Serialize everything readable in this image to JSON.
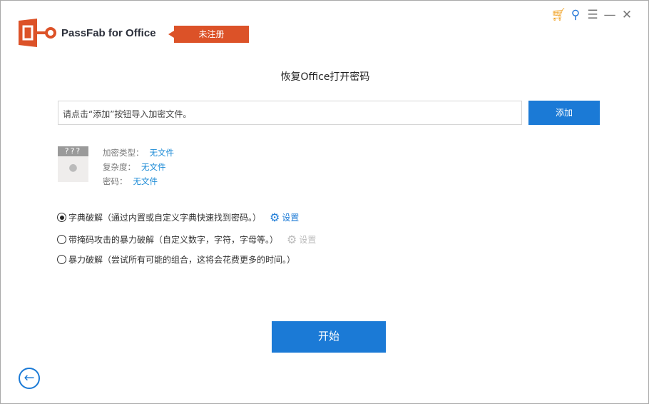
{
  "app": {
    "name": "PassFab for Office",
    "badge": "未注册"
  },
  "titlebar": {
    "icons": [
      "cart-icon",
      "key-icon",
      "menu-icon",
      "minimize-icon",
      "close-icon"
    ]
  },
  "main": {
    "title": "恢复Office打开密码",
    "file_input_placeholder": "请点击“添加”按钮导入加密文件。",
    "add_label": "添加",
    "thumb_text": "???",
    "info": [
      {
        "label": "加密类型：",
        "value": "无文件"
      },
      {
        "label": "复杂度：",
        "value": "无文件"
      },
      {
        "label": "密码：",
        "value": "无文件"
      }
    ],
    "options": [
      {
        "label": "字典破解（通过内置或自定义字典快速找到密码。）",
        "selected": true,
        "settings": "设置"
      },
      {
        "label": "带掩码攻击的暴力破解（自定义数字，字符，字母等。）",
        "selected": false,
        "settings": "设置"
      },
      {
        "label": "暴力破解（尝试所有可能的组合，这将会花费更多的时间。）",
        "selected": false
      }
    ],
    "start_label": "开始"
  },
  "colors": {
    "accent": "#1b7ad6",
    "brand": "#dc5228"
  }
}
